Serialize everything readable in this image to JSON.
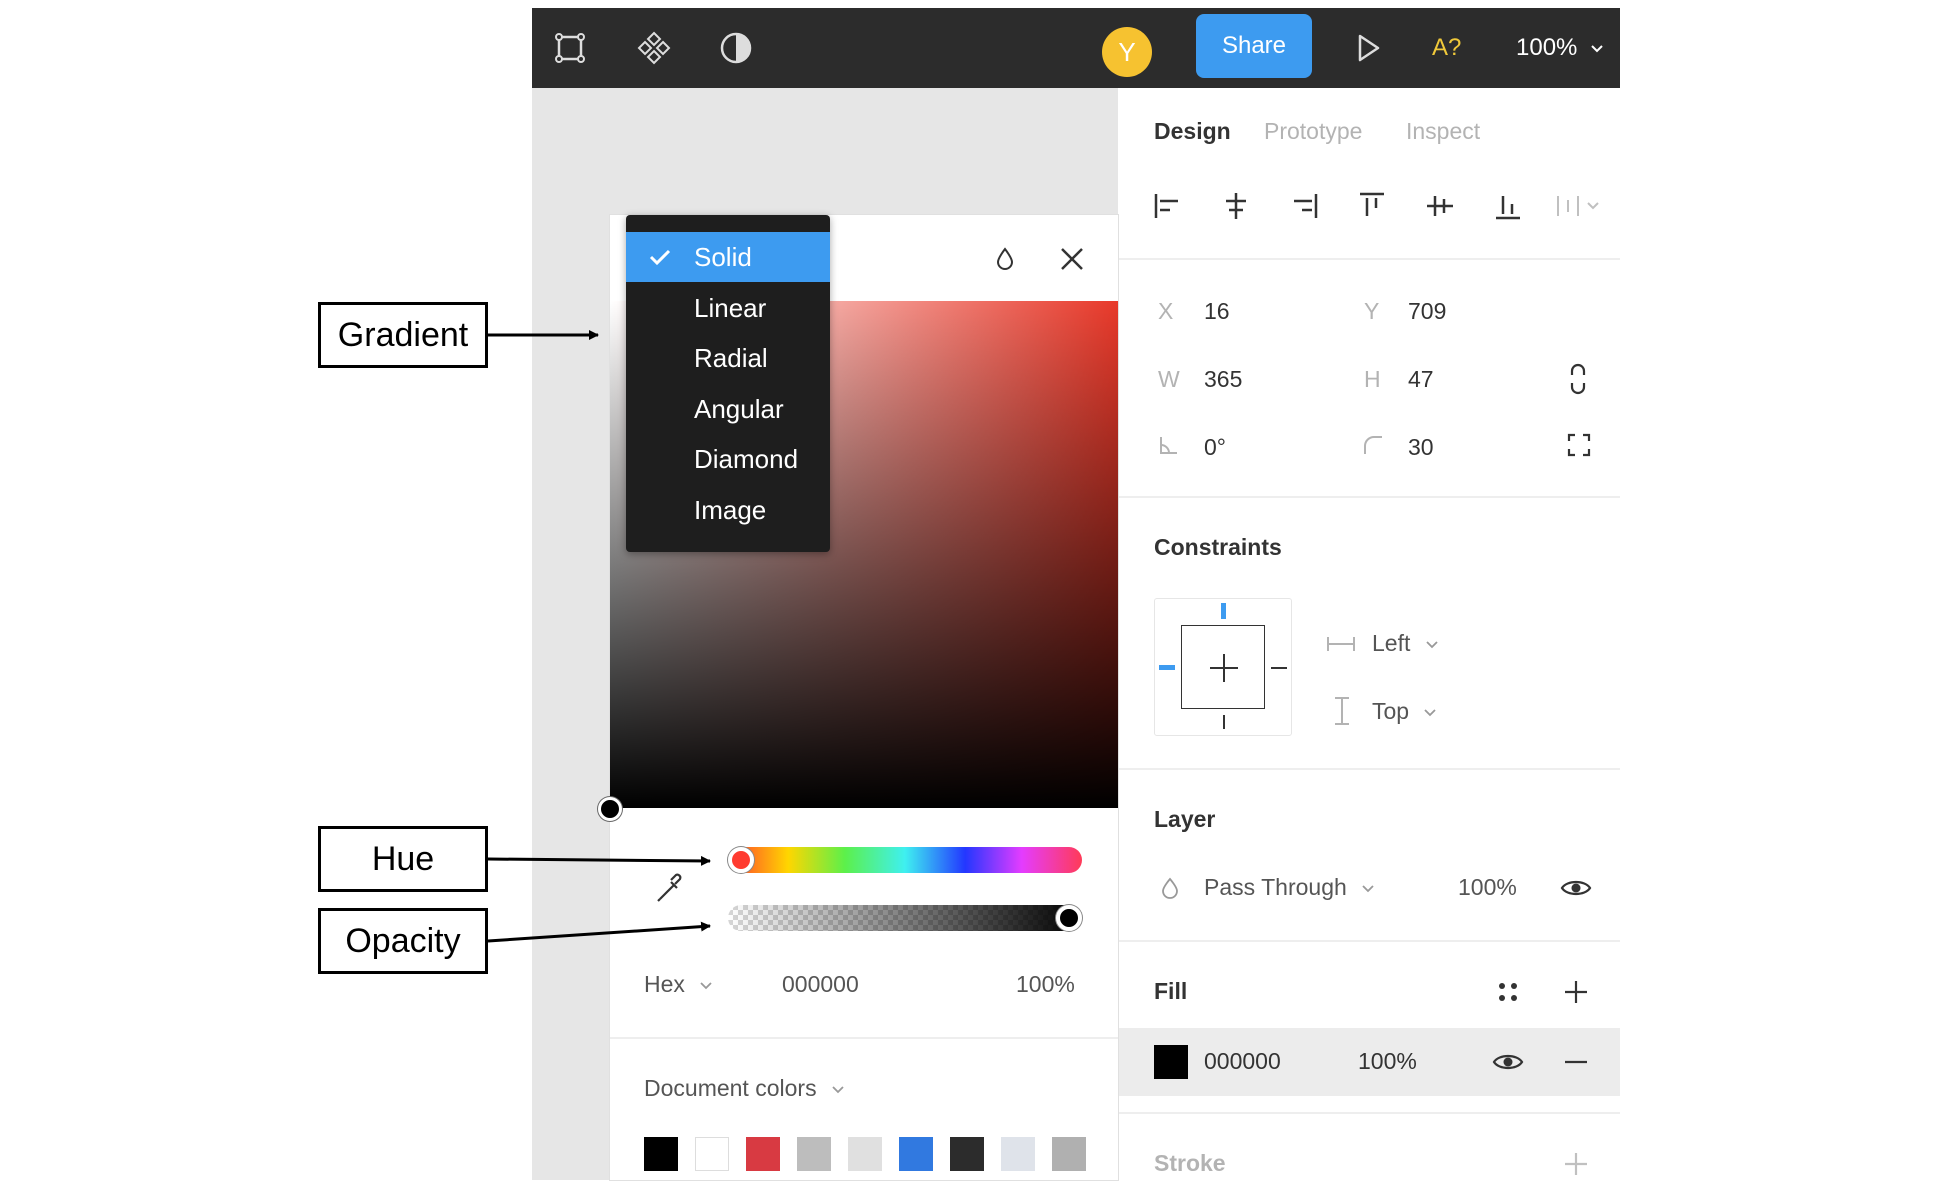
{
  "toolbar": {
    "icons": [
      "frame-icon",
      "component-icon",
      "contrast-icon",
      "play-icon",
      "chevron-down-icon"
    ],
    "avatar_initial": "Y",
    "share_label": "Share",
    "accessibility_label": "A?",
    "zoom_value": "100%"
  },
  "tabs": {
    "design": "Design",
    "prototype": "Prototype",
    "inspect": "Inspect",
    "active": "Design"
  },
  "align_icons": [
    "align-left-icon",
    "align-h-center-icon",
    "align-right-icon",
    "align-top-icon",
    "align-v-center-icon",
    "align-bottom-icon",
    "distribute-icon"
  ],
  "geometry": {
    "x_label": "X",
    "x_value": "16",
    "y_label": "Y",
    "y_value": "709",
    "w_label": "W",
    "w_value": "365",
    "h_label": "H",
    "h_value": "47",
    "rotation_value": "0°",
    "radius_value": "30"
  },
  "constraints": {
    "title": "Constraints",
    "horizontal": "Left",
    "vertical": "Top"
  },
  "layer": {
    "title": "Layer",
    "blend_mode": "Pass Through",
    "opacity": "100%"
  },
  "fill": {
    "title": "Fill",
    "hex": "000000",
    "opacity": "100%",
    "swatch_color": "#000000"
  },
  "stroke": {
    "title": "Stroke"
  },
  "picker": {
    "fill_types": [
      "Solid",
      "Linear",
      "Radial",
      "Angular",
      "Diamond",
      "Image"
    ],
    "selected_type": "Solid",
    "hue_knob_color": "#ff3b30",
    "hue": 0,
    "opacity_level": 1,
    "color_mode": "Hex",
    "hex": "000000",
    "opacity": "100%",
    "document_colors_label": "Document colors",
    "document_colors": [
      "#000000",
      "#ffffff",
      "#d83a42",
      "#bdbdbd",
      "#e0e0e0",
      "#3179e0",
      "#2c2c2c",
      "#dfe3ea",
      "#b0b0b0"
    ]
  },
  "annotations": {
    "gradient": "Gradient",
    "hue": "Hue",
    "opacity": "Opacity"
  },
  "colors": {
    "toolbar_bg": "#2c2c2c",
    "accent": "#3d9bf0",
    "avatar": "#f6c230",
    "canvas": "#e6e6e6"
  }
}
